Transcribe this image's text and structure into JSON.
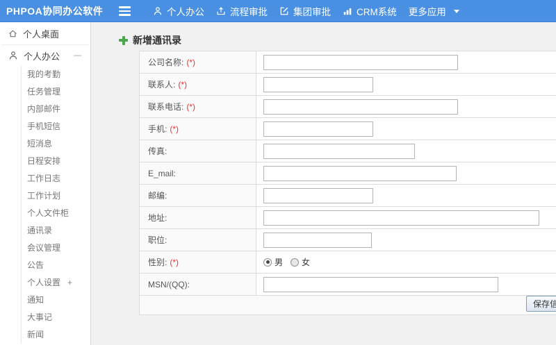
{
  "colors": {
    "header_bg": "#4a90e2",
    "header_text": "#ffffff",
    "plus_green": "#4aa74a",
    "required_red": "#e53333",
    "content_bg": "#f1f1f1",
    "label_cell_bg": "#fafafa",
    "border": "#dcdcdc"
  },
  "header": {
    "logo": "PHPOA协同办公软件",
    "menu_icon": "hamburger-icon",
    "nav": [
      {
        "id": "personal-office",
        "label": "个人办公",
        "icon": "user-icon"
      },
      {
        "id": "workflow-approval",
        "label": "流程审批",
        "icon": "share-icon"
      },
      {
        "id": "group-approval",
        "label": "集团审批",
        "icon": "edit-icon"
      },
      {
        "id": "crm-system",
        "label": "CRM系统",
        "icon": "chart-icon"
      },
      {
        "id": "more-apps",
        "label": "更多应用",
        "caret": "caret-down-icon"
      }
    ]
  },
  "sidebar": {
    "desktop_item": {
      "id": "personal-desktop",
      "label": "个人桌面",
      "icon": "home-icon"
    },
    "section": {
      "id": "personal-office-section",
      "label": "个人办公",
      "icon": "user-icon",
      "toggle": "—"
    },
    "items": [
      {
        "id": "my-attendance",
        "label": "我的考勤"
      },
      {
        "id": "task-management",
        "label": "任务管理"
      },
      {
        "id": "internal-mail",
        "label": "内部邮件"
      },
      {
        "id": "mobile-sms",
        "label": "手机短信"
      },
      {
        "id": "short-message",
        "label": "短消息"
      },
      {
        "id": "schedule",
        "label": "日程安排"
      },
      {
        "id": "work-log",
        "label": "工作日志"
      },
      {
        "id": "work-plan",
        "label": "工作计划"
      },
      {
        "id": "personal-file-cabinet",
        "label": "个人文件柜"
      },
      {
        "id": "contacts",
        "label": "通讯录"
      },
      {
        "id": "meeting-management",
        "label": "会议管理"
      },
      {
        "id": "announcement",
        "label": "公告"
      },
      {
        "id": "personal-settings",
        "label": "个人设置",
        "toggle": "+"
      },
      {
        "id": "notification",
        "label": "通知"
      },
      {
        "id": "milestones",
        "label": "大事记"
      },
      {
        "id": "news",
        "label": "新闻"
      }
    ]
  },
  "main": {
    "title": "新增通讯录",
    "form": {
      "required_marker": "(*)",
      "rows": [
        {
          "id": "company-name",
          "label": "公司名称:",
          "required": true,
          "type": "input",
          "value": "",
          "input_width": 280
        },
        {
          "id": "contact-person",
          "label": "联系人:",
          "required": true,
          "type": "input",
          "value": "",
          "input_width": 158
        },
        {
          "id": "contact-phone",
          "label": "联系电话:",
          "required": true,
          "type": "input",
          "value": "",
          "input_width": 280
        },
        {
          "id": "mobile",
          "label": "手机:",
          "required": true,
          "type": "input",
          "value": "",
          "input_width": 158
        },
        {
          "id": "fax",
          "label": "传真:",
          "required": false,
          "type": "input",
          "value": "",
          "input_width": 218
        },
        {
          "id": "email",
          "label": "E_mail:",
          "required": false,
          "type": "input",
          "value": "",
          "input_width": 278
        },
        {
          "id": "postal-code",
          "label": "邮编:",
          "required": false,
          "type": "input",
          "value": "",
          "input_width": 158
        },
        {
          "id": "address",
          "label": "地址:",
          "required": false,
          "type": "input",
          "value": "",
          "input_width": 397
        },
        {
          "id": "position",
          "label": "职位:",
          "required": false,
          "type": "input",
          "value": "",
          "input_width": 156
        },
        {
          "id": "gender",
          "label": "性别:",
          "required": true,
          "type": "radio",
          "options": [
            {
              "label": "男",
              "checked": true
            },
            {
              "label": "女",
              "checked": false
            }
          ]
        },
        {
          "id": "msn-qq",
          "label": "MSN/(QQ):",
          "required": false,
          "type": "input",
          "value": "",
          "input_width": 338
        }
      ],
      "save_button": "保存信息"
    }
  }
}
